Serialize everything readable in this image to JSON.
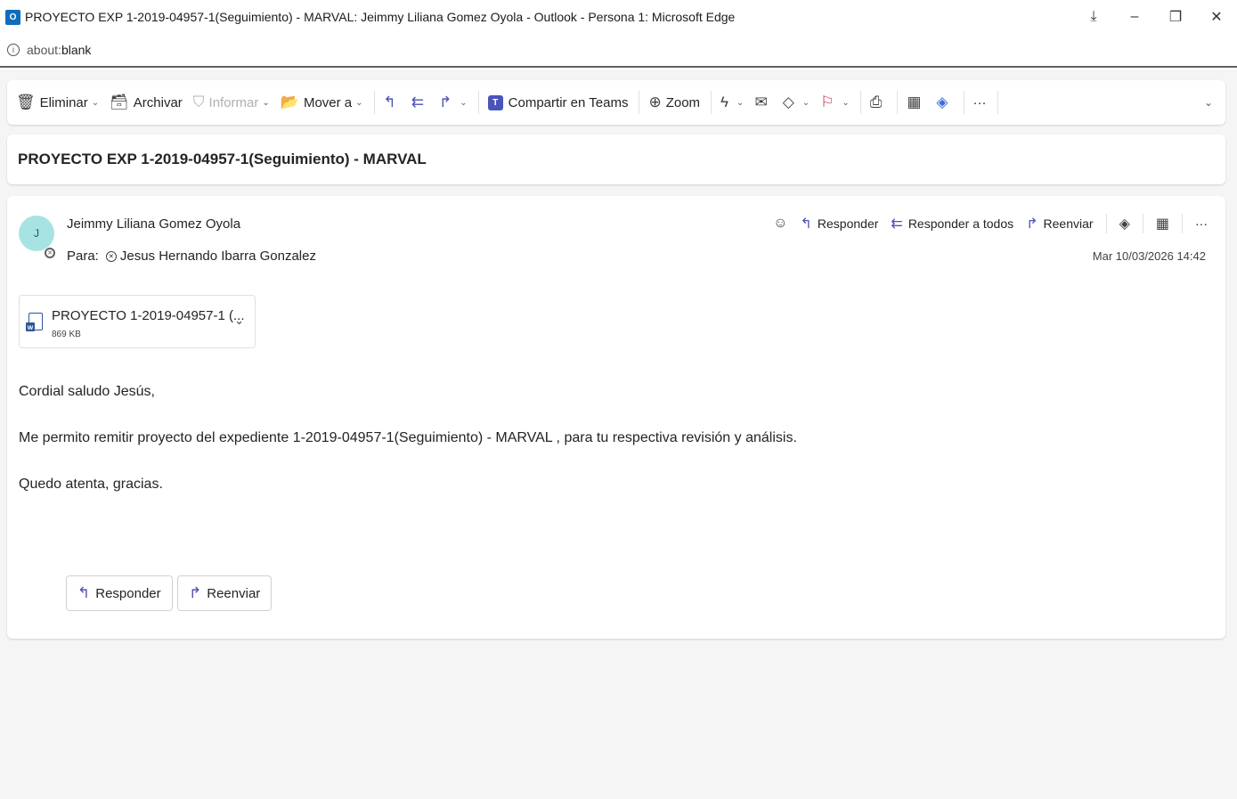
{
  "window": {
    "app_icon": "O",
    "title": "PROYECTO EXP 1-2019-04957-1(Seguimiento) - MARVAL: Jeimmy Liliana Gomez Oyola - Outlook - Persona 1: Microsoft Edge",
    "controls": {
      "download": "⤓",
      "minimize": "–",
      "restore": "❐",
      "close": "✕"
    }
  },
  "address": {
    "info": "i",
    "scheme": "about:",
    "page": "blank"
  },
  "toolbar": {
    "delete": "Eliminar",
    "archive": "Archivar",
    "report": "Informar",
    "move": "Mover a",
    "teams": "Compartir en Teams",
    "zoom": "Zoom",
    "more": "···"
  },
  "subject": "PROYECTO EXP 1-2019-04957-1(Seguimiento) - MARVAL",
  "message": {
    "avatar_initial": "J",
    "sender": "Jeimmy Liliana Gomez Oyola",
    "to_label": "Para:",
    "recipient": "Jesus Hernando Ibarra Gonzalez",
    "date": "Mar 10/03/2026 14:42",
    "actions": {
      "reply": "Responder",
      "reply_all": "Responder a todos",
      "forward": "Reenviar",
      "more": "···"
    },
    "attachment": {
      "name": "PROYECTO 1-2019-04957-1 (...",
      "size": "869 KB"
    },
    "body": [
      "Cordial saludo Jesús,",
      "Me permito remitir proyecto del expediente 1-2019-04957-1(Seguimiento) - MARVAL , para tu respectiva revisión y análisis.",
      "Quedo atenta, gracias."
    ],
    "bottom_buttons": {
      "reply": "Responder",
      "forward": "Reenviar"
    }
  }
}
